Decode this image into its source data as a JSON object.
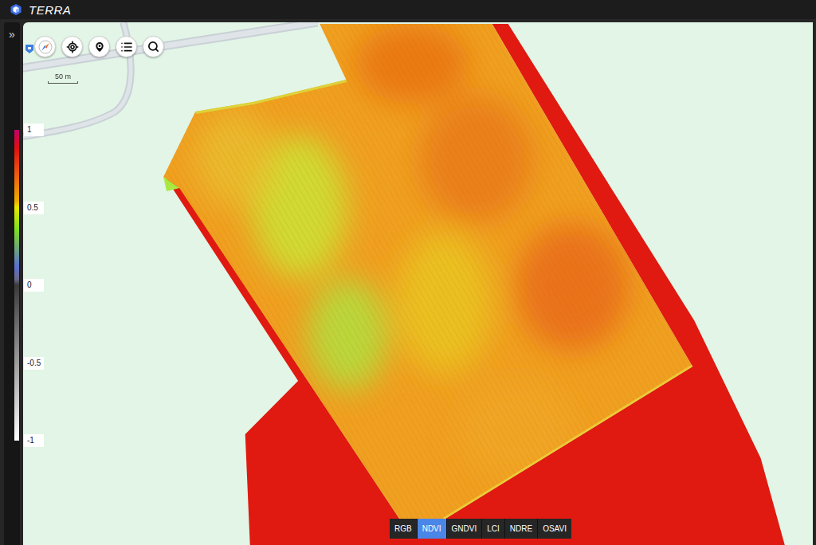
{
  "app": {
    "title": "TERRA"
  },
  "sidebar": {
    "toggle": "»"
  },
  "scale": {
    "label": "50 m"
  },
  "legend": {
    "ticks": [
      "1",
      "0.5",
      "0",
      "-0.5",
      "-1"
    ]
  },
  "layers": [
    {
      "label": "RGB",
      "selected": false
    },
    {
      "label": "NDVI",
      "selected": true
    },
    {
      "label": "GNDVI",
      "selected": false
    },
    {
      "label": "LCI",
      "selected": false
    },
    {
      "label": "NDRE",
      "selected": false
    },
    {
      "label": "OSAVI",
      "selected": false
    }
  ]
}
